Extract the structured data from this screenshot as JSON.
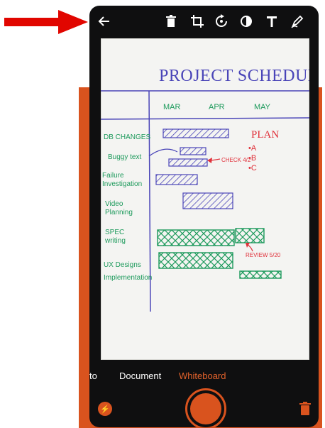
{
  "colors": {
    "accent": "#d9531e",
    "annotation_arrow": "#e10600",
    "ink_blue": "#4a45b8",
    "ink_green": "#1d9a5c",
    "ink_red": "#e0303a"
  },
  "toolbar": {
    "icons": [
      "back-arrow-icon",
      "delete-icon",
      "crop-icon",
      "rotate-icon",
      "filter-icon",
      "text-icon",
      "pen-icon"
    ]
  },
  "whiteboard": {
    "title": "PROJECT SCHEDULE",
    "months": [
      "MAR",
      "APR",
      "MAY"
    ],
    "rows": [
      "DB CHANGES",
      "Buggy text",
      "Failure Investigation",
      "Video Planning",
      "SPEC writing",
      "UX Designs",
      "Implementation"
    ],
    "plan": {
      "heading": "PLAN",
      "items": [
        "A",
        "B",
        "C"
      ]
    },
    "notes": {
      "check": "CHECK 4/2",
      "review": "REVIEW 5/20"
    }
  },
  "modes": {
    "partial": "to",
    "document": "Document",
    "whiteboard": "Whiteboard"
  },
  "bottom": {
    "flash_label": "⚡"
  }
}
